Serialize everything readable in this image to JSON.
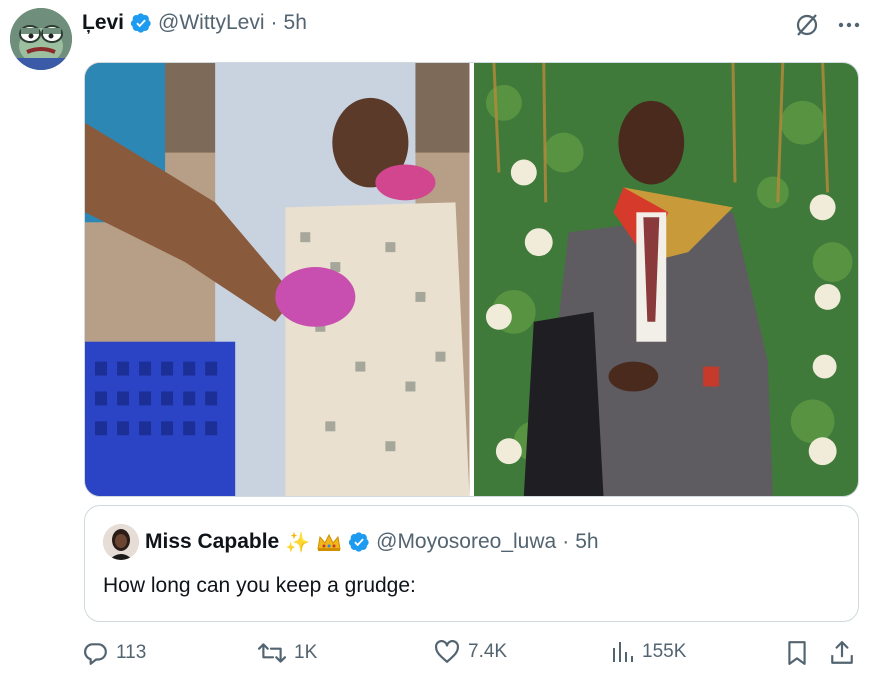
{
  "post": {
    "display_name": "Ļevi",
    "handle": "@WittyLevi",
    "separator": "·",
    "time": "5h"
  },
  "quoted_post": {
    "display_name": "Miss Capable",
    "handle": "@Moyosoreo_luwa",
    "separator": "·",
    "time": "5h",
    "text": "How long can you keep a grudge:"
  },
  "metrics": {
    "replies": "113",
    "reposts": "1K",
    "likes": "7.4K",
    "views": "155K"
  },
  "icons": {
    "avatar": "frog-avatar",
    "verified": "verified-badge-icon",
    "grok": "grok-icon",
    "more": "more-icon",
    "reply": "reply-icon",
    "repost": "repost-icon",
    "like": "heart-icon",
    "views": "views-icon",
    "bookmark": "bookmark-icon",
    "share": "share-icon"
  },
  "colors": {
    "verified_blue": "#1d9bf0",
    "muted_text": "#536471",
    "primary_text": "#0f1419",
    "border": "#cfd9de"
  }
}
